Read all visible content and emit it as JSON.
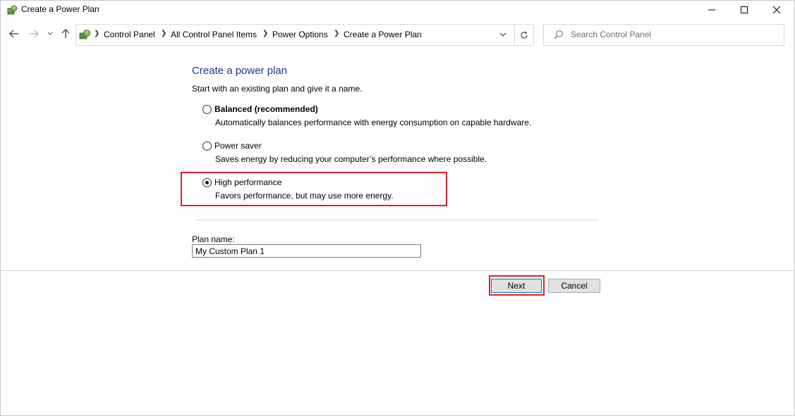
{
  "window": {
    "title": "Create a Power Plan",
    "icon": "power-options-icon"
  },
  "navigation": {
    "breadcrumbs": [
      "Control Panel",
      "All Control Panel Items",
      "Power Options",
      "Create a Power Plan"
    ],
    "search_placeholder": "Search Control Panel"
  },
  "content": {
    "heading": "Create a power plan",
    "intro": "Start with an existing plan and give it a name.",
    "options": [
      {
        "label": "Balanced (recommended)",
        "description": "Automatically balances performance with energy consumption on capable hardware.",
        "selected": false,
        "bold": true
      },
      {
        "label": "Power saver",
        "description": "Saves energy by reducing your computer’s performance where possible.",
        "selected": false,
        "bold": false
      },
      {
        "label": "High performance",
        "description": "Favors performance, but may use more energy.",
        "selected": true,
        "bold": false
      }
    ],
    "plan_name_label": "Plan name:",
    "plan_name_value": "My Custom Plan 1"
  },
  "buttons": {
    "next": "Next",
    "cancel": "Cancel"
  },
  "colors": {
    "heading": "#1e3287",
    "highlight": "#e01e2b",
    "default_button_border": "#0078d7"
  }
}
